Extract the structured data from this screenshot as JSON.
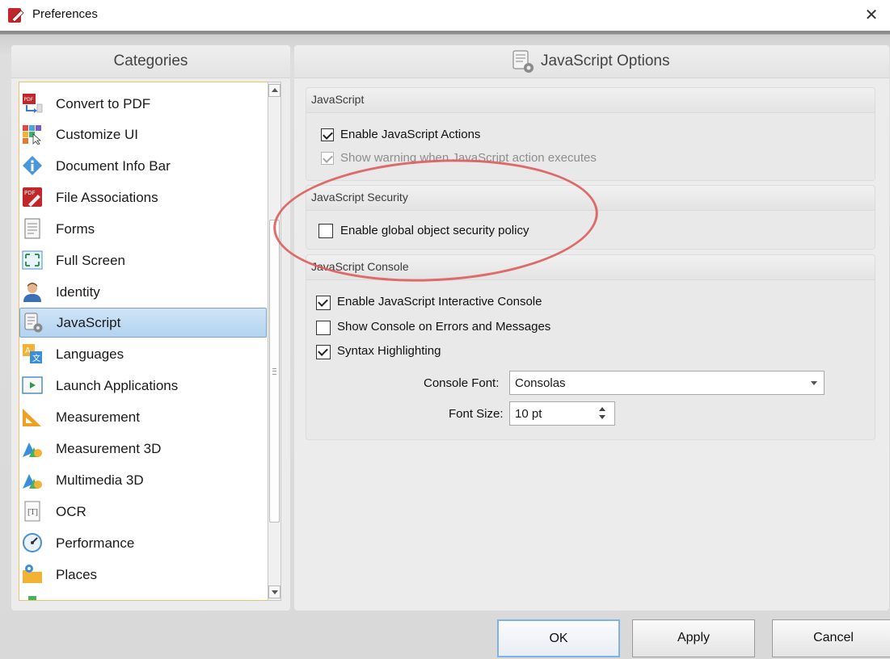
{
  "window": {
    "title": "Preferences",
    "close_glyph": "✕"
  },
  "categories": {
    "header": "Categories",
    "items": [
      {
        "label": "Convert to PDF",
        "icon": "convert-to-pdf-icon"
      },
      {
        "label": "Customize UI",
        "icon": "customize-ui-icon"
      },
      {
        "label": "Document Info Bar",
        "icon": "info-icon"
      },
      {
        "label": "File Associations",
        "icon": "file-associations-icon"
      },
      {
        "label": "Forms",
        "icon": "forms-icon"
      },
      {
        "label": "Full Screen",
        "icon": "full-screen-icon"
      },
      {
        "label": "Identity",
        "icon": "identity-icon"
      },
      {
        "label": "JavaScript",
        "icon": "javascript-icon"
      },
      {
        "label": "Languages",
        "icon": "languages-icon"
      },
      {
        "label": "Launch Applications",
        "icon": "launch-applications-icon"
      },
      {
        "label": "Measurement",
        "icon": "measurement-icon"
      },
      {
        "label": "Measurement 3D",
        "icon": "measurement-3d-icon"
      },
      {
        "label": "Multimedia 3D",
        "icon": "multimedia-3d-icon"
      },
      {
        "label": "OCR",
        "icon": "ocr-icon"
      },
      {
        "label": "Performance",
        "icon": "performance-icon"
      },
      {
        "label": "Places",
        "icon": "places-icon"
      }
    ],
    "selected": "JavaScript"
  },
  "options": {
    "header": "JavaScript Options",
    "javascript_group": {
      "title": "JavaScript",
      "enable_actions": {
        "label": "Enable JavaScript Actions",
        "checked": true
      },
      "show_warning": {
        "label": "Show warning when JavaScript action executes",
        "checked": true,
        "disabled": true
      }
    },
    "security_group": {
      "title": "JavaScript Security",
      "global_policy": {
        "label": "Enable global object security policy",
        "checked": false
      }
    },
    "console_group": {
      "title": "JavaScript Console",
      "interactive_console": {
        "label": "Enable JavaScript Interactive Console",
        "checked": true
      },
      "show_console": {
        "label": "Show Console on Errors and Messages",
        "checked": false
      },
      "syntax_highlighting": {
        "label": "Syntax Highlighting",
        "checked": true
      },
      "console_font_label": "Console Font:",
      "console_font_value": "Consolas",
      "font_size_label": "Font Size:",
      "font_size_value": "10 pt"
    }
  },
  "buttons": {
    "ok": "OK",
    "apply": "Apply",
    "cancel": "Cancel"
  },
  "colors": {
    "annotation_ellipse": "#dd5c5c",
    "selection": "#b3d3f0",
    "list_border": "#e7c36a"
  }
}
